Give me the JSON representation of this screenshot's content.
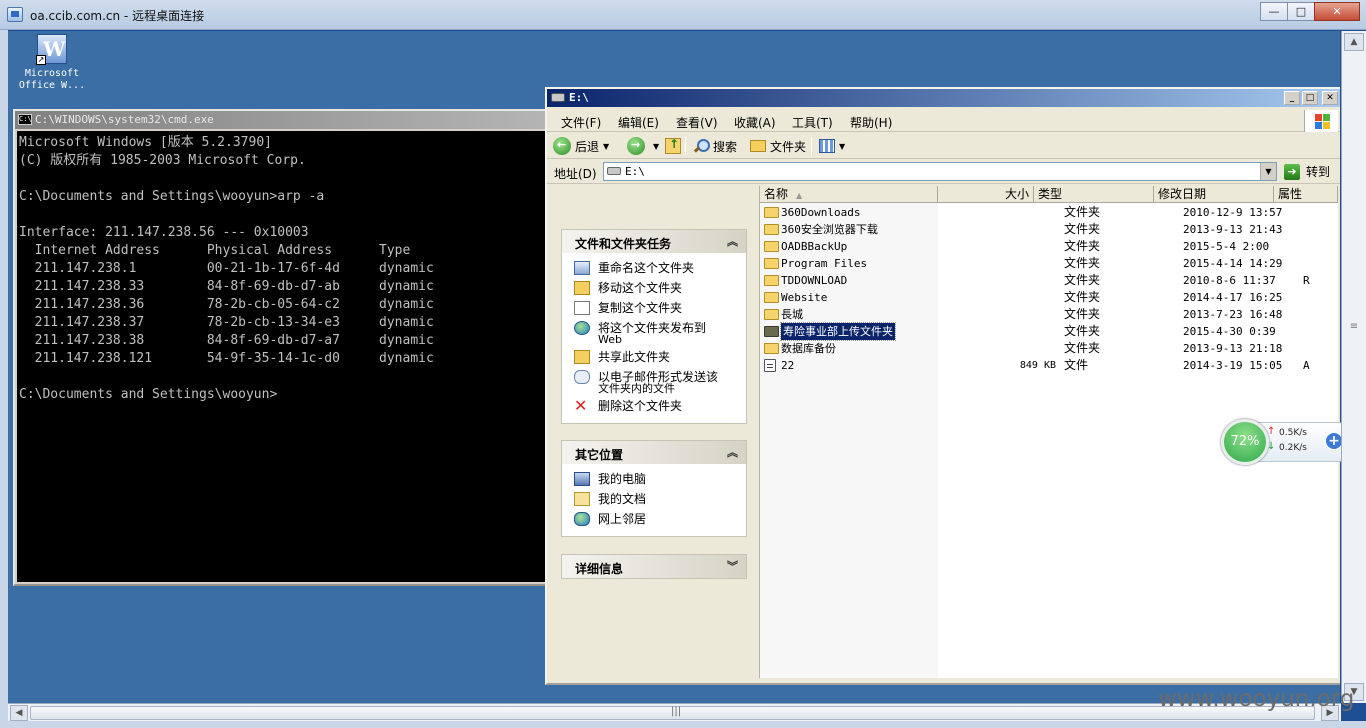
{
  "rdp": {
    "title": "oa.ccib.com.cn - 远程桌面连接",
    "min_label": "—",
    "max_label": "□",
    "close_label": "✕"
  },
  "desktop": {
    "icon_label_line1": "Microsoft",
    "icon_label_line2": "Office W..."
  },
  "cmd": {
    "title": "C:\\WINDOWS\\system32\\cmd.exe",
    "icon_text": "C:\\",
    "lines": [
      "Microsoft Windows [版本 5.2.3790]",
      "(C) 版权所有 1985-2003 Microsoft Corp.",
      "",
      "C:\\Documents and Settings\\wooyun>arp -a",
      "",
      "Interface: 211.147.238.56 --- 0x10003",
      "  Internet Address      Physical Address      Type",
      "  211.147.238.1         00-21-1b-17-6f-4d     dynamic",
      "  211.147.238.33        84-8f-69-db-d7-ab     dynamic",
      "  211.147.238.36        78-2b-cb-05-64-c2     dynamic",
      "  211.147.238.37        78-2b-cb-13-34-e3     dynamic",
      "  211.147.238.38        84-8f-69-db-d7-a7     dynamic",
      "  211.147.238.121       54-9f-35-14-1c-d0     dynamic",
      "",
      "C:\\Documents and Settings\\wooyun>"
    ]
  },
  "explorer": {
    "title": "E:\\",
    "menu": [
      "文件(F)",
      "编辑(E)",
      "查看(V)",
      "收藏(A)",
      "工具(T)",
      "帮助(H)"
    ],
    "toolbar": {
      "back": "后退",
      "search": "搜索",
      "folders": "文件夹"
    },
    "address": {
      "label": "地址(D)",
      "value": "E:\\",
      "go": "转到"
    },
    "tasks_panel": {
      "title": "文件和文件夹任务",
      "items": [
        {
          "line1": "重命名这个文件夹",
          "line2": "",
          "icon": "rename-icon"
        },
        {
          "line1": "移动这个文件夹",
          "line2": "",
          "icon": "move-icon"
        },
        {
          "line1": "复制这个文件夹",
          "line2": "",
          "icon": "copy-icon"
        },
        {
          "line1": "将这个文件夹发布到",
          "line2": "Web",
          "icon": "globe-icon"
        },
        {
          "line1": "共享此文件夹",
          "line2": "",
          "icon": "share-icon"
        },
        {
          "line1": "以电子邮件形式发送该",
          "line2": "文件夹内的文件",
          "icon": "mail-icon"
        },
        {
          "line1": "删除这个文件夹",
          "line2": "",
          "icon": "delete-icon"
        }
      ]
    },
    "places_panel": {
      "title": "其它位置",
      "items": [
        "我的电脑",
        "我的文档",
        "网上邻居"
      ]
    },
    "details_panel": {
      "title": "详细信息"
    },
    "columns": {
      "name": "名称",
      "size": "大小",
      "type": "类型",
      "date": "修改日期",
      "attr": "属性"
    },
    "files": [
      {
        "name": "360Downloads",
        "size": "",
        "type": "文件夹",
        "date": "2010-12-9 13:57",
        "attr": "",
        "kind": "folder"
      },
      {
        "name": "360安全浏览器下载",
        "size": "",
        "type": "文件夹",
        "date": "2013-9-13 21:43",
        "attr": "",
        "kind": "folder"
      },
      {
        "name": "OADBBackUp",
        "size": "",
        "type": "文件夹",
        "date": "2015-5-4 2:00",
        "attr": "",
        "kind": "folder"
      },
      {
        "name": "Program Files",
        "size": "",
        "type": "文件夹",
        "date": "2015-4-14 14:29",
        "attr": "",
        "kind": "folder"
      },
      {
        "name": "TDDOWNLOAD",
        "size": "",
        "type": "文件夹",
        "date": "2010-8-6 11:37",
        "attr": "R",
        "kind": "folder"
      },
      {
        "name": "Website",
        "size": "",
        "type": "文件夹",
        "date": "2014-4-17 16:25",
        "attr": "",
        "kind": "folder"
      },
      {
        "name": "長城",
        "size": "",
        "type": "文件夹",
        "date": "2013-7-23 16:48",
        "attr": "",
        "kind": "folder"
      },
      {
        "name": "寿险事业部上传文件夹",
        "size": "",
        "type": "文件夹",
        "date": "2015-4-30 0:39",
        "attr": "",
        "kind": "folder-selected"
      },
      {
        "name": "数据库备份",
        "size": "",
        "type": "文件夹",
        "date": "2013-9-13 21:18",
        "attr": "",
        "kind": "folder"
      },
      {
        "name": "22",
        "size": "849 KB",
        "type": "文件",
        "date": "2014-3-19 15:05",
        "attr": "A",
        "kind": "file"
      }
    ]
  },
  "net_widget": {
    "percent": "72%",
    "up": "0.5K/s",
    "down": "0.2K/s"
  },
  "watermark": "www.wooyun.org"
}
